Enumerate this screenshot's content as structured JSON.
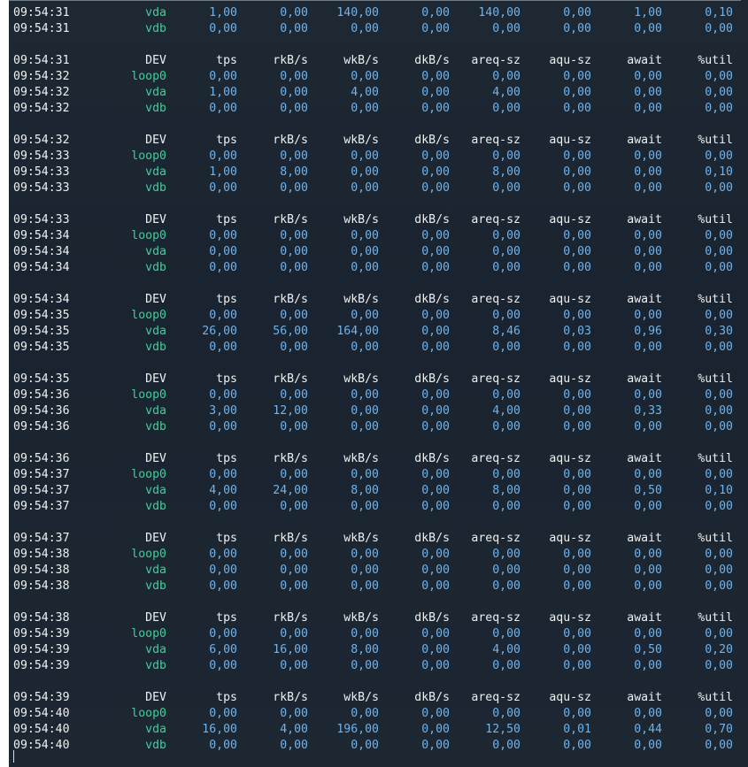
{
  "window": {
    "title": ""
  },
  "terminal": {
    "colors": {
      "background": "#1b2530",
      "timestamp": "#eef0f2",
      "device": "#3fcf9a",
      "number": "#6fb3ec"
    },
    "lines": [
      {
        "kind": "data",
        "time": "09:54:31",
        "dev": "vda",
        "tps": "1,00",
        "rkbs": "0,00",
        "wkbs": "140,00",
        "dkbs": "0,00",
        "areq": "140,00",
        "aqu": "0,00",
        "await": "1,00",
        "util": "0,10"
      },
      {
        "kind": "data",
        "time": "09:54:31",
        "dev": "vdb",
        "tps": "0,00",
        "rkbs": "0,00",
        "wkbs": "0,00",
        "dkbs": "0,00",
        "areq": "0,00",
        "aqu": "0,00",
        "await": "0,00",
        "util": "0,00"
      },
      {
        "kind": "blank"
      },
      {
        "kind": "header",
        "time": "09:54:31",
        "dev": "DEV",
        "tps": "tps",
        "rkbs": "rkB/s",
        "wkbs": "wkB/s",
        "dkbs": "dkB/s",
        "areq": "areq-sz",
        "aqu": "aqu-sz",
        "await": "await",
        "util": "%util"
      },
      {
        "kind": "data",
        "time": "09:54:32",
        "dev": "loop0",
        "tps": "0,00",
        "rkbs": "0,00",
        "wkbs": "0,00",
        "dkbs": "0,00",
        "areq": "0,00",
        "aqu": "0,00",
        "await": "0,00",
        "util": "0,00"
      },
      {
        "kind": "data",
        "time": "09:54:32",
        "dev": "vda",
        "tps": "1,00",
        "rkbs": "0,00",
        "wkbs": "4,00",
        "dkbs": "0,00",
        "areq": "4,00",
        "aqu": "0,00",
        "await": "0,00",
        "util": "0,00"
      },
      {
        "kind": "data",
        "time": "09:54:32",
        "dev": "vdb",
        "tps": "0,00",
        "rkbs": "0,00",
        "wkbs": "0,00",
        "dkbs": "0,00",
        "areq": "0,00",
        "aqu": "0,00",
        "await": "0,00",
        "util": "0,00"
      },
      {
        "kind": "blank"
      },
      {
        "kind": "header",
        "time": "09:54:32",
        "dev": "DEV",
        "tps": "tps",
        "rkbs": "rkB/s",
        "wkbs": "wkB/s",
        "dkbs": "dkB/s",
        "areq": "areq-sz",
        "aqu": "aqu-sz",
        "await": "await",
        "util": "%util"
      },
      {
        "kind": "data",
        "time": "09:54:33",
        "dev": "loop0",
        "tps": "0,00",
        "rkbs": "0,00",
        "wkbs": "0,00",
        "dkbs": "0,00",
        "areq": "0,00",
        "aqu": "0,00",
        "await": "0,00",
        "util": "0,00"
      },
      {
        "kind": "data",
        "time": "09:54:33",
        "dev": "vda",
        "tps": "1,00",
        "rkbs": "8,00",
        "wkbs": "0,00",
        "dkbs": "0,00",
        "areq": "8,00",
        "aqu": "0,00",
        "await": "0,00",
        "util": "0,10"
      },
      {
        "kind": "data",
        "time": "09:54:33",
        "dev": "vdb",
        "tps": "0,00",
        "rkbs": "0,00",
        "wkbs": "0,00",
        "dkbs": "0,00",
        "areq": "0,00",
        "aqu": "0,00",
        "await": "0,00",
        "util": "0,00"
      },
      {
        "kind": "blank"
      },
      {
        "kind": "header",
        "time": "09:54:33",
        "dev": "DEV",
        "tps": "tps",
        "rkbs": "rkB/s",
        "wkbs": "wkB/s",
        "dkbs": "dkB/s",
        "areq": "areq-sz",
        "aqu": "aqu-sz",
        "await": "await",
        "util": "%util"
      },
      {
        "kind": "data",
        "time": "09:54:34",
        "dev": "loop0",
        "tps": "0,00",
        "rkbs": "0,00",
        "wkbs": "0,00",
        "dkbs": "0,00",
        "areq": "0,00",
        "aqu": "0,00",
        "await": "0,00",
        "util": "0,00"
      },
      {
        "kind": "data",
        "time": "09:54:34",
        "dev": "vda",
        "tps": "0,00",
        "rkbs": "0,00",
        "wkbs": "0,00",
        "dkbs": "0,00",
        "areq": "0,00",
        "aqu": "0,00",
        "await": "0,00",
        "util": "0,00"
      },
      {
        "kind": "data",
        "time": "09:54:34",
        "dev": "vdb",
        "tps": "0,00",
        "rkbs": "0,00",
        "wkbs": "0,00",
        "dkbs": "0,00",
        "areq": "0,00",
        "aqu": "0,00",
        "await": "0,00",
        "util": "0,00"
      },
      {
        "kind": "blank"
      },
      {
        "kind": "header",
        "time": "09:54:34",
        "dev": "DEV",
        "tps": "tps",
        "rkbs": "rkB/s",
        "wkbs": "wkB/s",
        "dkbs": "dkB/s",
        "areq": "areq-sz",
        "aqu": "aqu-sz",
        "await": "await",
        "util": "%util"
      },
      {
        "kind": "data",
        "time": "09:54:35",
        "dev": "loop0",
        "tps": "0,00",
        "rkbs": "0,00",
        "wkbs": "0,00",
        "dkbs": "0,00",
        "areq": "0,00",
        "aqu": "0,00",
        "await": "0,00",
        "util": "0,00"
      },
      {
        "kind": "data",
        "time": "09:54:35",
        "dev": "vda",
        "tps": "26,00",
        "rkbs": "56,00",
        "wkbs": "164,00",
        "dkbs": "0,00",
        "areq": "8,46",
        "aqu": "0,03",
        "await": "0,96",
        "util": "0,30"
      },
      {
        "kind": "data",
        "time": "09:54:35",
        "dev": "vdb",
        "tps": "0,00",
        "rkbs": "0,00",
        "wkbs": "0,00",
        "dkbs": "0,00",
        "areq": "0,00",
        "aqu": "0,00",
        "await": "0,00",
        "util": "0,00"
      },
      {
        "kind": "blank"
      },
      {
        "kind": "header",
        "time": "09:54:35",
        "dev": "DEV",
        "tps": "tps",
        "rkbs": "rkB/s",
        "wkbs": "wkB/s",
        "dkbs": "dkB/s",
        "areq": "areq-sz",
        "aqu": "aqu-sz",
        "await": "await",
        "util": "%util"
      },
      {
        "kind": "data",
        "time": "09:54:36",
        "dev": "loop0",
        "tps": "0,00",
        "rkbs": "0,00",
        "wkbs": "0,00",
        "dkbs": "0,00",
        "areq": "0,00",
        "aqu": "0,00",
        "await": "0,00",
        "util": "0,00"
      },
      {
        "kind": "data",
        "time": "09:54:36",
        "dev": "vda",
        "tps": "3,00",
        "rkbs": "12,00",
        "wkbs": "0,00",
        "dkbs": "0,00",
        "areq": "4,00",
        "aqu": "0,00",
        "await": "0,33",
        "util": "0,00"
      },
      {
        "kind": "data",
        "time": "09:54:36",
        "dev": "vdb",
        "tps": "0,00",
        "rkbs": "0,00",
        "wkbs": "0,00",
        "dkbs": "0,00",
        "areq": "0,00",
        "aqu": "0,00",
        "await": "0,00",
        "util": "0,00"
      },
      {
        "kind": "blank"
      },
      {
        "kind": "header",
        "time": "09:54:36",
        "dev": "DEV",
        "tps": "tps",
        "rkbs": "rkB/s",
        "wkbs": "wkB/s",
        "dkbs": "dkB/s",
        "areq": "areq-sz",
        "aqu": "aqu-sz",
        "await": "await",
        "util": "%util"
      },
      {
        "kind": "data",
        "time": "09:54:37",
        "dev": "loop0",
        "tps": "0,00",
        "rkbs": "0,00",
        "wkbs": "0,00",
        "dkbs": "0,00",
        "areq": "0,00",
        "aqu": "0,00",
        "await": "0,00",
        "util": "0,00"
      },
      {
        "kind": "data",
        "time": "09:54:37",
        "dev": "vda",
        "tps": "4,00",
        "rkbs": "24,00",
        "wkbs": "8,00",
        "dkbs": "0,00",
        "areq": "8,00",
        "aqu": "0,00",
        "await": "0,50",
        "util": "0,10"
      },
      {
        "kind": "data",
        "time": "09:54:37",
        "dev": "vdb",
        "tps": "0,00",
        "rkbs": "0,00",
        "wkbs": "0,00",
        "dkbs": "0,00",
        "areq": "0,00",
        "aqu": "0,00",
        "await": "0,00",
        "util": "0,00"
      },
      {
        "kind": "blank"
      },
      {
        "kind": "header",
        "time": "09:54:37",
        "dev": "DEV",
        "tps": "tps",
        "rkbs": "rkB/s",
        "wkbs": "wkB/s",
        "dkbs": "dkB/s",
        "areq": "areq-sz",
        "aqu": "aqu-sz",
        "await": "await",
        "util": "%util"
      },
      {
        "kind": "data",
        "time": "09:54:38",
        "dev": "loop0",
        "tps": "0,00",
        "rkbs": "0,00",
        "wkbs": "0,00",
        "dkbs": "0,00",
        "areq": "0,00",
        "aqu": "0,00",
        "await": "0,00",
        "util": "0,00"
      },
      {
        "kind": "data",
        "time": "09:54:38",
        "dev": "vda",
        "tps": "0,00",
        "rkbs": "0,00",
        "wkbs": "0,00",
        "dkbs": "0,00",
        "areq": "0,00",
        "aqu": "0,00",
        "await": "0,00",
        "util": "0,00"
      },
      {
        "kind": "data",
        "time": "09:54:38",
        "dev": "vdb",
        "tps": "0,00",
        "rkbs": "0,00",
        "wkbs": "0,00",
        "dkbs": "0,00",
        "areq": "0,00",
        "aqu": "0,00",
        "await": "0,00",
        "util": "0,00"
      },
      {
        "kind": "blank"
      },
      {
        "kind": "header",
        "time": "09:54:38",
        "dev": "DEV",
        "tps": "tps",
        "rkbs": "rkB/s",
        "wkbs": "wkB/s",
        "dkbs": "dkB/s",
        "areq": "areq-sz",
        "aqu": "aqu-sz",
        "await": "await",
        "util": "%util"
      },
      {
        "kind": "data",
        "time": "09:54:39",
        "dev": "loop0",
        "tps": "0,00",
        "rkbs": "0,00",
        "wkbs": "0,00",
        "dkbs": "0,00",
        "areq": "0,00",
        "aqu": "0,00",
        "await": "0,00",
        "util": "0,00"
      },
      {
        "kind": "data",
        "time": "09:54:39",
        "dev": "vda",
        "tps": "6,00",
        "rkbs": "16,00",
        "wkbs": "8,00",
        "dkbs": "0,00",
        "areq": "4,00",
        "aqu": "0,00",
        "await": "0,50",
        "util": "0,20"
      },
      {
        "kind": "data",
        "time": "09:54:39",
        "dev": "vdb",
        "tps": "0,00",
        "rkbs": "0,00",
        "wkbs": "0,00",
        "dkbs": "0,00",
        "areq": "0,00",
        "aqu": "0,00",
        "await": "0,00",
        "util": "0,00"
      },
      {
        "kind": "blank"
      },
      {
        "kind": "header",
        "time": "09:54:39",
        "dev": "DEV",
        "tps": "tps",
        "rkbs": "rkB/s",
        "wkbs": "wkB/s",
        "dkbs": "dkB/s",
        "areq": "areq-sz",
        "aqu": "aqu-sz",
        "await": "await",
        "util": "%util"
      },
      {
        "kind": "data",
        "time": "09:54:40",
        "dev": "loop0",
        "tps": "0,00",
        "rkbs": "0,00",
        "wkbs": "0,00",
        "dkbs": "0,00",
        "areq": "0,00",
        "aqu": "0,00",
        "await": "0,00",
        "util": "0,00"
      },
      {
        "kind": "data",
        "time": "09:54:40",
        "dev": "vda",
        "tps": "16,00",
        "rkbs": "4,00",
        "wkbs": "196,00",
        "dkbs": "0,00",
        "areq": "12,50",
        "aqu": "0,01",
        "await": "0,44",
        "util": "0,70"
      },
      {
        "kind": "data",
        "time": "09:54:40",
        "dev": "vdb",
        "tps": "0,00",
        "rkbs": "0,00",
        "wkbs": "0,00",
        "dkbs": "0,00",
        "areq": "0,00",
        "aqu": "0,00",
        "await": "0,00",
        "util": "0,00"
      }
    ]
  }
}
